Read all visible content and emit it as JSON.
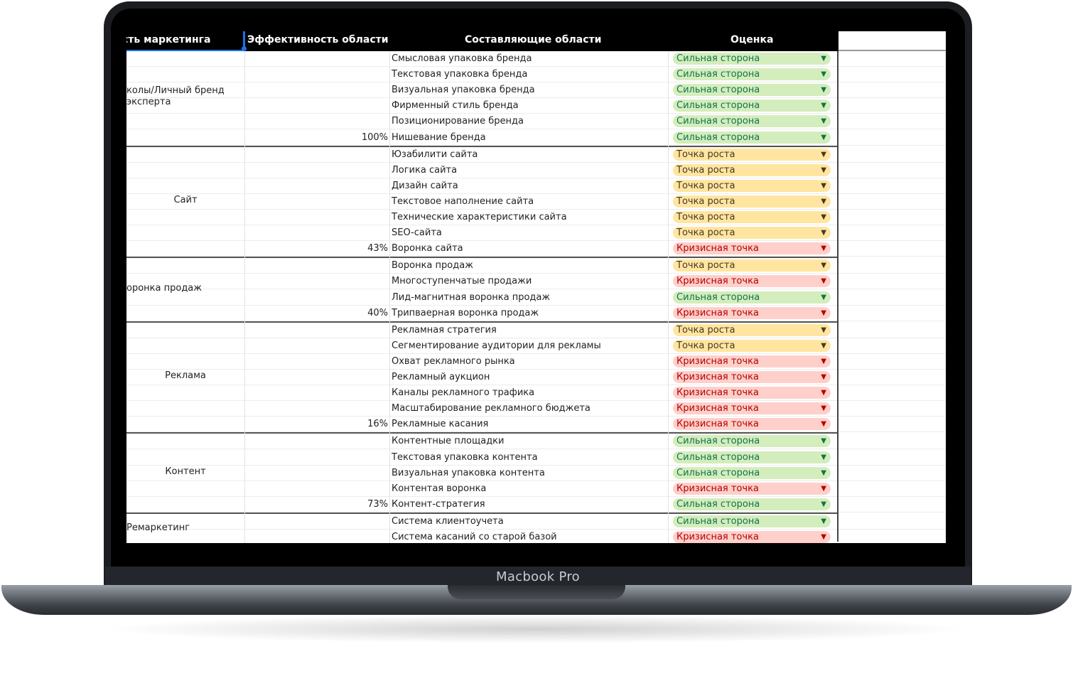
{
  "device": {
    "label": "Macbook Pro"
  },
  "sheet": {
    "headers": {
      "area": "сть маркетинга",
      "efficiency": "Эффективность области",
      "components": "Составляющие области",
      "score": "Оценка"
    },
    "groups": [
      {
        "area": "колы/Личный бренд эксперта",
        "efficiency": "100%",
        "rows": [
          {
            "component": "Смысловая упаковка бренда",
            "score": "Сильная сторона",
            "status": "strong"
          },
          {
            "component": "Текстовая упаковка бренда",
            "score": "Сильная сторона",
            "status": "strong"
          },
          {
            "component": "Визуальная упаковка бренда",
            "score": "Сильная сторона",
            "status": "strong"
          },
          {
            "component": "Фирменный стиль бренда",
            "score": "Сильная сторона",
            "status": "strong"
          },
          {
            "component": "Позиционирование бренда",
            "score": "Сильная сторона",
            "status": "strong"
          },
          {
            "component": "Нишевание бренда",
            "score": "Сильная сторона",
            "status": "strong"
          }
        ]
      },
      {
        "area": "Сайт",
        "efficiency": "43%",
        "rows": [
          {
            "component": "Юзабилити сайта",
            "score": "Точка роста",
            "status": "growth"
          },
          {
            "component": "Логика сайта",
            "score": "Точка роста",
            "status": "growth"
          },
          {
            "component": "Дизайн сайта",
            "score": "Точка роста",
            "status": "growth"
          },
          {
            "component": "Текстовое наполнение сайта",
            "score": "Точка роста",
            "status": "growth"
          },
          {
            "component": "Технические характеристики сайта",
            "score": "Точка роста",
            "status": "growth"
          },
          {
            "component": "SEO-сайта",
            "score": "Точка роста",
            "status": "growth"
          },
          {
            "component": "Воронка сайта",
            "score": "Кризисная точка",
            "status": "crisis"
          }
        ]
      },
      {
        "area": "оронка продаж",
        "efficiency": "40%",
        "rows": [
          {
            "component": "Воронка продаж",
            "score": "Точка роста",
            "status": "growth"
          },
          {
            "component": "Многоступенчатые продажи",
            "score": "Кризисная точка",
            "status": "crisis"
          },
          {
            "component": "Лид-магнитная воронка продаж",
            "score": "Сильная сторона",
            "status": "strong"
          },
          {
            "component": "Трипваерная воронка продаж",
            "score": "Кризисная точка",
            "status": "crisis"
          }
        ]
      },
      {
        "area": "Реклама",
        "efficiency": "16%",
        "rows": [
          {
            "component": "Рекламная стратегия",
            "score": "Точка роста",
            "status": "growth"
          },
          {
            "component": "Сегментирование аудитории для рекламы",
            "score": "Точка роста",
            "status": "growth"
          },
          {
            "component": "Охват рекламного рынка",
            "score": "Кризисная точка",
            "status": "crisis"
          },
          {
            "component": "Рекламный аукцион",
            "score": "Кризисная точка",
            "status": "crisis"
          },
          {
            "component": "Каналы рекламного трафика",
            "score": "Кризисная точка",
            "status": "crisis"
          },
          {
            "component": "Масштабирование рекламного бюджета",
            "score": "Кризисная точка",
            "status": "crisis"
          },
          {
            "component": "Рекламные касания",
            "score": "Кризисная точка",
            "status": "crisis"
          }
        ]
      },
      {
        "area": "Контент",
        "efficiency": "73%",
        "rows": [
          {
            "component": "Контентные площадки",
            "score": "Сильная сторона",
            "status": "strong"
          },
          {
            "component": "Текстовая упаковка контента",
            "score": "Сильная сторона",
            "status": "strong"
          },
          {
            "component": "Визуальная упаковка контента",
            "score": "Сильная сторона",
            "status": "strong"
          },
          {
            "component": "Контентая воронка",
            "score": "Кризисная точка",
            "status": "crisis"
          },
          {
            "component": "Контент-стратегия",
            "score": "Сильная сторона",
            "status": "strong"
          }
        ]
      },
      {
        "area": "Ремаркетинг",
        "efficiency": "",
        "rows": [
          {
            "component": "Система клиентоучета",
            "score": "Сильная сторона",
            "status": "strong"
          },
          {
            "component": "Система касаний со старой базой",
            "score": "Кризисная точка",
            "status": "crisis"
          }
        ]
      }
    ],
    "dropdown_icon": "triangle-down-icon",
    "colors": {
      "strong_bg": "#d4edbc",
      "strong_text": "#11734b",
      "growth_bg": "#ffe5a0",
      "growth_text": "#473821",
      "crisis_bg": "#ffcfc9",
      "crisis_text": "#b10202",
      "selection": "#1a73e8"
    }
  }
}
